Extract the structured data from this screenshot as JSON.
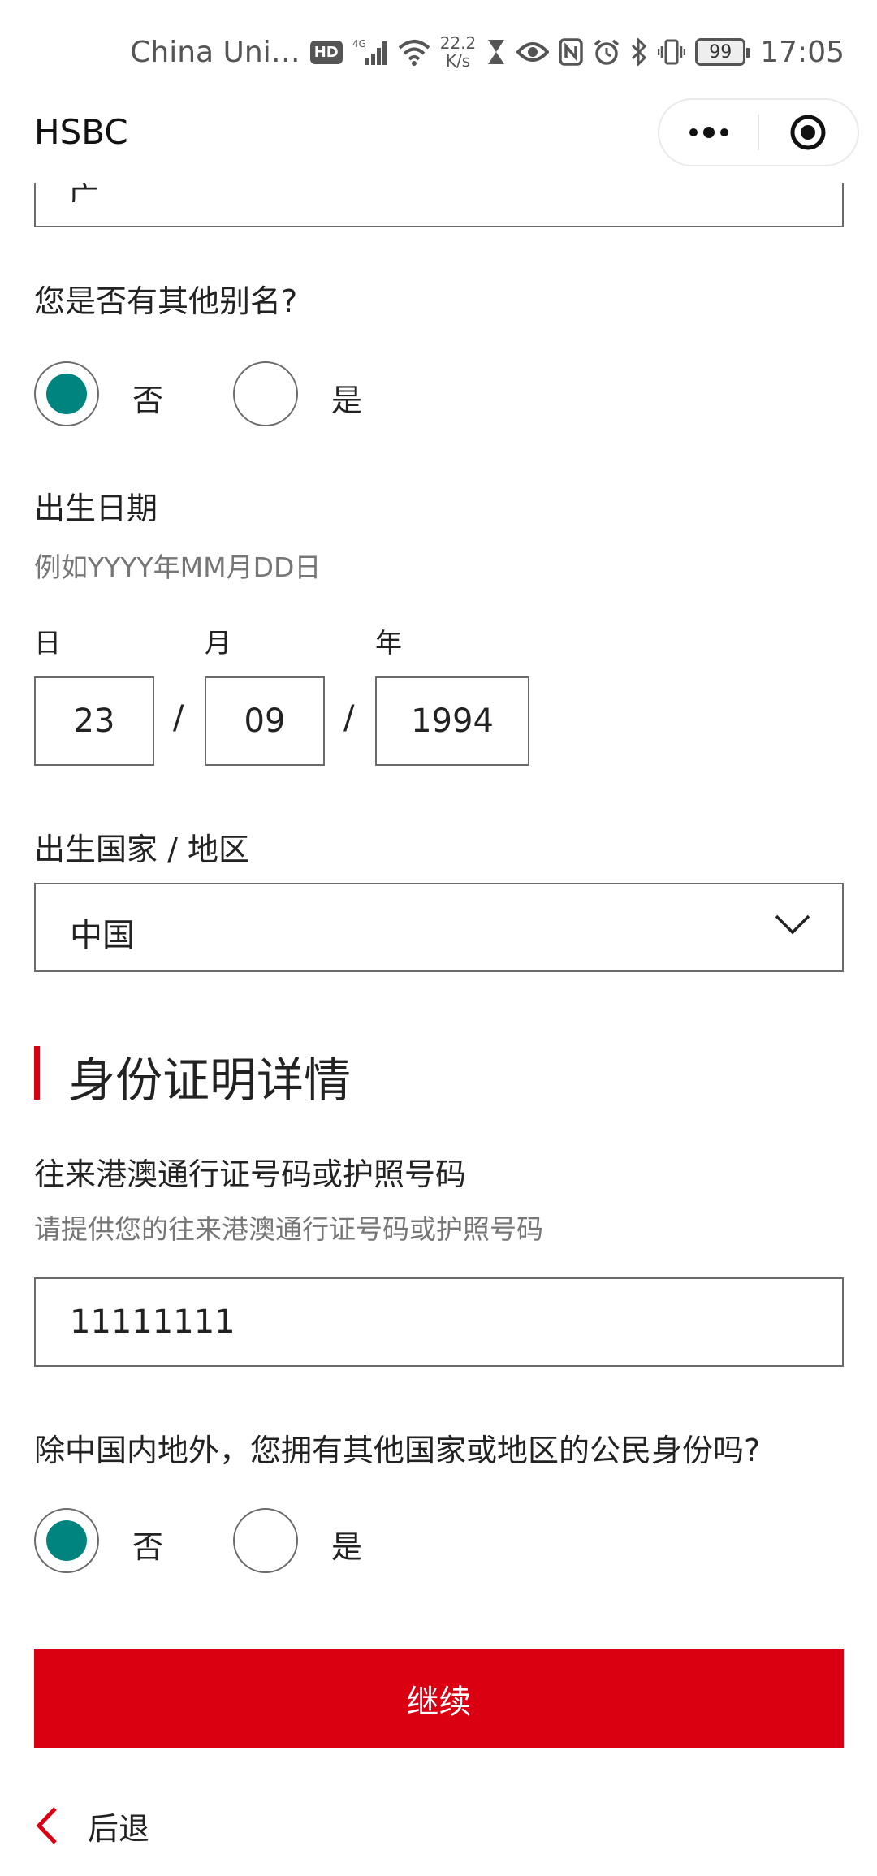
{
  "status_bar": {
    "carrier": "China Uni…",
    "hd": "HD",
    "signal": "4G",
    "net_speed_value": "22.2",
    "net_speed_unit": "K/s",
    "battery": "99",
    "time": "17:05"
  },
  "app": {
    "title": "HSBC",
    "more_icon": "more-dots-icon",
    "close_icon": "target-circle-icon"
  },
  "form": {
    "top_field_partial_text": "广",
    "alias_question": "您是否有其他别名?",
    "alias_options": {
      "no": "否",
      "yes": "是",
      "selected": "no"
    },
    "dob_label": "出生日期",
    "dob_hint": "例如YYYY年MM月DD日",
    "dob_day_caption": "日",
    "dob_month_caption": "月",
    "dob_year_caption": "年",
    "dob_day": "23",
    "dob_month": "09",
    "dob_year": "1994",
    "dob_separator": "/",
    "birth_country_label": "出生国家 / 地区",
    "birth_country_value": "中国",
    "id_section_title": "身份证明详情",
    "passport_label": "往来港澳通行证号码或护照号码",
    "passport_hint": "请提供您的往来港澳通行证号码或护照号码",
    "passport_value": "11111111",
    "citizenship_question": "除中国内地外，您拥有其他国家或地区的公民身份吗?",
    "citizenship_options": {
      "no": "否",
      "yes": "是",
      "selected": "no"
    },
    "continue_label": "继续",
    "back_label": "后退"
  },
  "colors": {
    "brand_red": "#db0011",
    "radio_teal": "#00847f",
    "border_gray": "#6b6b6b",
    "hint_gray": "#767676"
  }
}
